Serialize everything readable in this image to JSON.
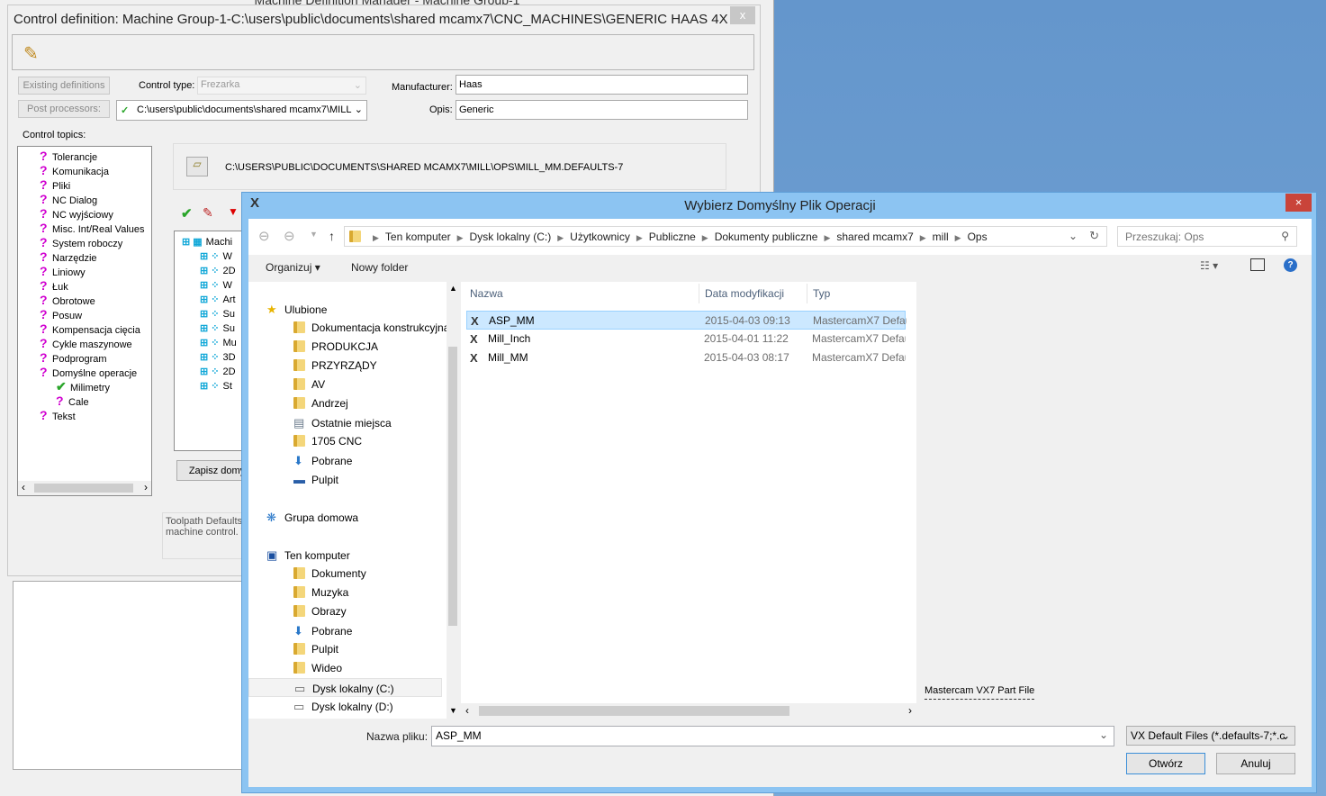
{
  "background_window": {
    "title": "Machine Definition Manager - Machine Group-1"
  },
  "control_definition": {
    "title": "Control definition: Machine Group-1-C:\\users\\public\\documents\\shared mcamx7\\CNC_MACHINES\\GENERIC HAAS 4X ...",
    "close": "x",
    "existing_definitions": "Existing definitions",
    "post_processors": "Post processors:",
    "control_type_label": "Control type:",
    "control_type_value": "Frezarka",
    "post_path": "C:\\users\\public\\documents\\shared mcamx7\\MILL",
    "manufacturer_label": "Manufacturer:",
    "manufacturer_value": "Haas",
    "opis_label": "Opis:",
    "opis_value": "Generic",
    "control_topics_label": "Control topics:",
    "topics": [
      {
        "label": "Tolerancje",
        "icon": "question"
      },
      {
        "label": "Komunikacja",
        "icon": "question"
      },
      {
        "label": "Pliki",
        "icon": "question"
      },
      {
        "label": "NC Dialog",
        "icon": "question"
      },
      {
        "label": "NC wyjściowy",
        "icon": "question"
      },
      {
        "label": "Misc. Int/Real Values",
        "icon": "question"
      },
      {
        "label": "System roboczy",
        "icon": "question"
      },
      {
        "label": "Narzędzie",
        "icon": "question"
      },
      {
        "label": "Liniowy",
        "icon": "question"
      },
      {
        "label": "Łuk",
        "icon": "question"
      },
      {
        "label": "Obrotowe",
        "icon": "question"
      },
      {
        "label": "Posuw",
        "icon": "question"
      },
      {
        "label": "Kompensacja cięcia",
        "icon": "question"
      },
      {
        "label": "Cykle maszynowe",
        "icon": "question"
      },
      {
        "label": "Podprogram",
        "icon": "question"
      },
      {
        "label": "Domyślne operacje",
        "icon": "question"
      },
      {
        "label": "Milimetry",
        "icon": "check",
        "indent": 1
      },
      {
        "label": "Cale",
        "icon": "question",
        "indent": 1
      },
      {
        "label": "Tekst",
        "icon": "question"
      }
    ],
    "defaults_path": "C:\\USERS\\PUBLIC\\DOCUMENTS\\SHARED MCAMX7\\MILL\\OPS\\MILL_MM.DEFAULTS-7",
    "ops_tree": [
      "Machi",
      "W",
      "2D",
      "W",
      "Art",
      "Su",
      "Su",
      "Mu",
      "3D",
      "2D",
      "St"
    ],
    "save_default": "Zapisz domy",
    "description": "Toolpath Defaults\nmachine control. T"
  },
  "dialog": {
    "title": "Wybierz Domyślny Plik Operacji",
    "close": "×",
    "breadcrumb": [
      "Ten komputer",
      "Dysk lokalny (C:)",
      "Użytkownicy",
      "Publiczne",
      "Dokumenty publiczne",
      "shared mcamx7",
      "mill",
      "Ops"
    ],
    "search_placeholder": "Przeszukaj: Ops",
    "organize": "Organizuj ▾",
    "new_folder": "Nowy folder",
    "nav": [
      {
        "label": "Ulubione",
        "level": 0,
        "icon": "star"
      },
      {
        "label": "Dokumentacja konstrukcyjna",
        "level": 1,
        "icon": "folder"
      },
      {
        "label": "PRODUKCJA",
        "level": 1,
        "icon": "folder"
      },
      {
        "label": "PRZYRZĄDY",
        "level": 1,
        "icon": "folder"
      },
      {
        "label": "AV",
        "level": 1,
        "icon": "folder"
      },
      {
        "label": "Andrzej",
        "level": 1,
        "icon": "folder"
      },
      {
        "label": "Ostatnie miejsca",
        "level": 1,
        "icon": "recent"
      },
      {
        "label": "1705 CNC",
        "level": 1,
        "icon": "folder"
      },
      {
        "label": "Pobrane",
        "level": 1,
        "icon": "downloads"
      },
      {
        "label": "Pulpit",
        "level": 1,
        "icon": "desktop"
      },
      {
        "label": "",
        "level": 0,
        "icon": ""
      },
      {
        "label": "Grupa domowa",
        "level": 0,
        "icon": "homegroup"
      },
      {
        "label": "",
        "level": 0,
        "icon": ""
      },
      {
        "label": "Ten komputer",
        "level": 0,
        "icon": "computer"
      },
      {
        "label": "Dokumenty",
        "level": 1,
        "icon": "folder"
      },
      {
        "label": "Muzyka",
        "level": 1,
        "icon": "folder"
      },
      {
        "label": "Obrazy",
        "level": 1,
        "icon": "folder"
      },
      {
        "label": "Pobrane",
        "level": 1,
        "icon": "downloads"
      },
      {
        "label": "Pulpit",
        "level": 1,
        "icon": "folder"
      },
      {
        "label": "Wideo",
        "level": 1,
        "icon": "folder"
      },
      {
        "label": "Dysk lokalny (C:)",
        "level": 1,
        "icon": "drive",
        "selected": true
      },
      {
        "label": "Dysk lokalny (D:)",
        "level": 1,
        "icon": "drive"
      }
    ],
    "columns": {
      "name": "Nazwa",
      "date": "Data modyfikacji",
      "type": "Typ"
    },
    "files": [
      {
        "name": "ASP_MM",
        "date": "2015-04-03 09:13",
        "type": "MastercamX7 Defau",
        "selected": true
      },
      {
        "name": "Mill_Inch",
        "date": "2015-04-01 11:22",
        "type": "MastercamX7 Defau"
      },
      {
        "name": "Mill_MM",
        "date": "2015-04-03 08:17",
        "type": "MastercamX7 Defau"
      }
    ],
    "preview_text": "Mastercam VX7 Part File",
    "filename_label": "Nazwa pliku:",
    "filename_value": "ASP_MM",
    "filter": "VX Default Files (*.defaults-7;*.c",
    "open": "Otwórz",
    "cancel": "Anuluj",
    "colors": {
      "titlebar": "#8cc4f2",
      "close": "#c9443a",
      "selection": "#cce8ff"
    }
  }
}
